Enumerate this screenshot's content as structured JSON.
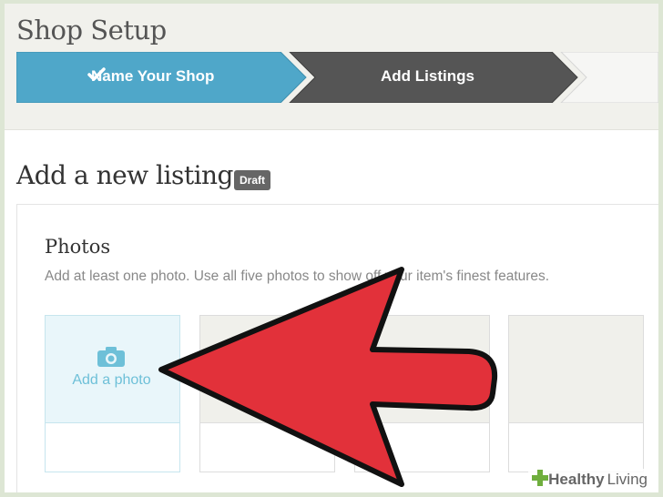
{
  "header": {
    "title": "Shop Setup",
    "steps": [
      {
        "label": "Name Your Shop",
        "state": "completed",
        "icon": "check-icon",
        "color": "#4fa7c9"
      },
      {
        "label": "Add Listings",
        "state": "current",
        "color": "#555555"
      }
    ]
  },
  "listing": {
    "title": "Add a new listing",
    "badge": "Draft"
  },
  "photos": {
    "title": "Photos",
    "help": "Add at least one photo. Use all five photos to show off your item's finest features.",
    "add_label": "Add a photo",
    "add_icon": "camera-icon"
  },
  "overlay": {
    "arrow_color": "#e2313a"
  },
  "watermark": {
    "brand": "Healthy",
    "suffix": "Living"
  }
}
